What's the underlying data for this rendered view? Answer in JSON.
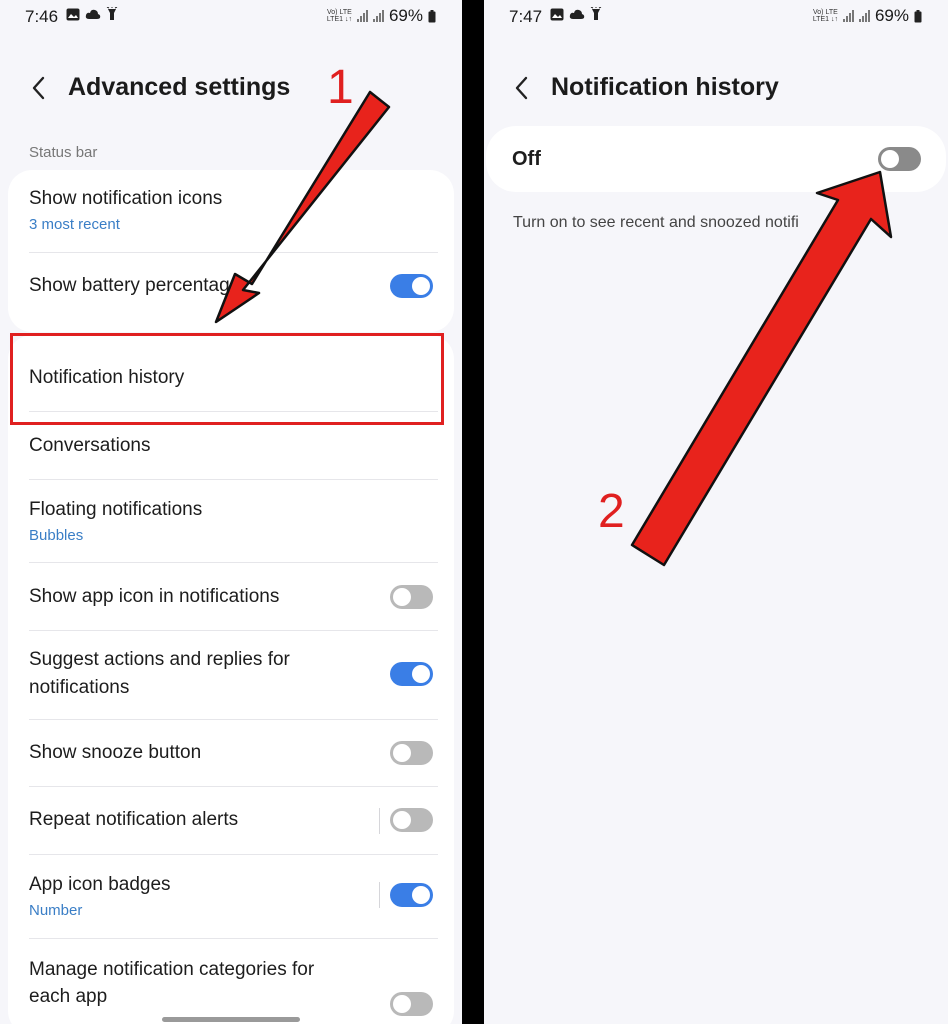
{
  "left_screen": {
    "status": {
      "time": "7:46",
      "battery": "69%",
      "net_top": "Vo) LTE",
      "net_bottom": "LTE1 ↓↑"
    },
    "title": "Advanced settings",
    "section_label": "Status bar",
    "rows": [
      {
        "title": "Show notification icons",
        "sub": "3 most recent"
      },
      {
        "title": "Show battery percentage",
        "toggle": "on"
      },
      {
        "title": "Notification history"
      },
      {
        "title": "Conversations"
      },
      {
        "title": "Floating notifications",
        "sub": "Bubbles"
      },
      {
        "title": "Show app icon in notifications",
        "toggle": "off"
      },
      {
        "title": "Suggest actions and replies for",
        "title2": "notifications",
        "toggle": "on"
      },
      {
        "title": "Show snooze button",
        "toggle": "off"
      },
      {
        "title": "Repeat notification alerts",
        "toggle": "off"
      },
      {
        "title": "App icon badges",
        "sub": "Number",
        "toggle": "on"
      },
      {
        "title": "Manage notification categories for",
        "title2": "each app",
        "toggle": "off"
      }
    ]
  },
  "right_screen": {
    "status": {
      "time": "7:47",
      "battery": "69%",
      "net_top": "Vo) LTE",
      "net_bottom": "LTE1 ↓↑"
    },
    "title": "Notification history",
    "master_label": "Off",
    "master_toggle": "off",
    "hint": "Turn on to see recent and snoozed notifi"
  },
  "annotations": {
    "step1": "1",
    "step2": "2",
    "arrow_color": "#e8231c",
    "highlight_color": "#e02020"
  },
  "colors": {
    "toggle_on": "#3a7ee6",
    "toggle_off": "#8a8a8a",
    "sub_text": "#3a7ec6",
    "background": "#f6f6fa"
  }
}
